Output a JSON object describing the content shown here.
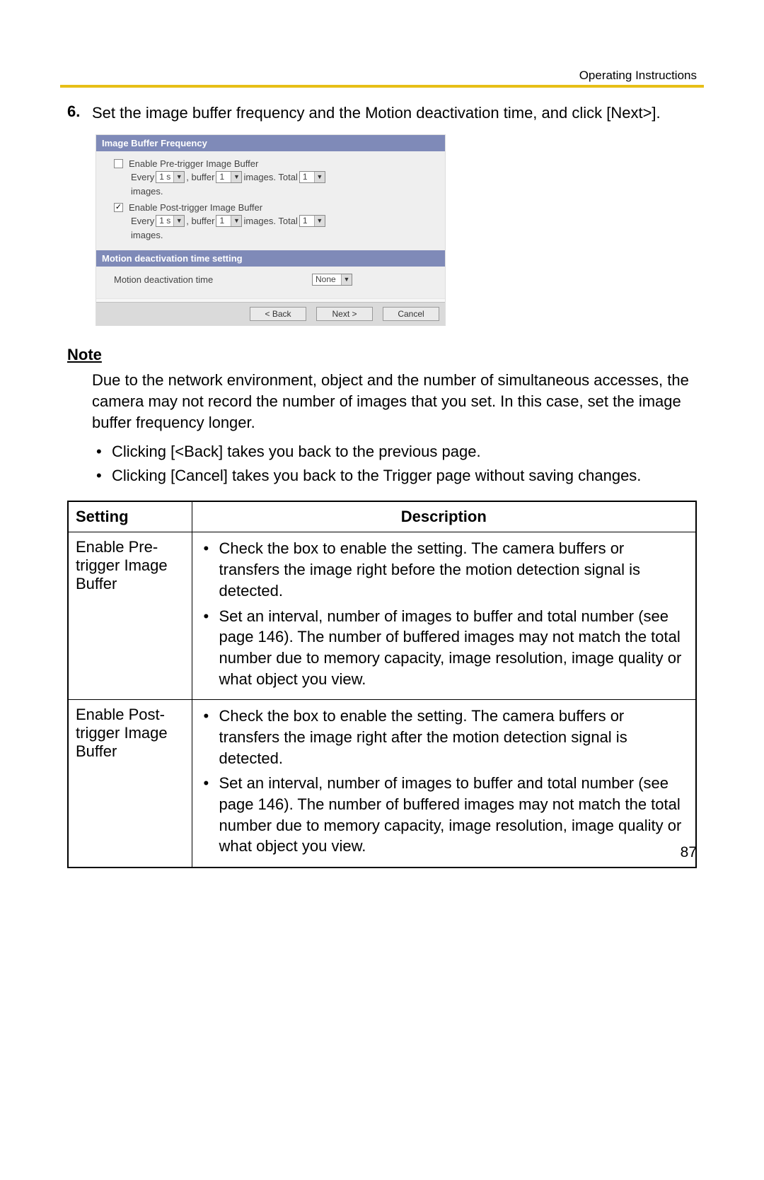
{
  "header": {
    "label": "Operating Instructions"
  },
  "step": {
    "number": "6.",
    "text": "Set the image buffer frequency and the Motion deactivation time, and click [Next>]."
  },
  "dialog": {
    "section1_title": "Image Buffer Frequency",
    "pre": {
      "checked": false,
      "label": "Enable Pre-trigger Image Buffer",
      "every_label": "Every",
      "every_value": "1 s",
      "buffer_label": ", buffer",
      "buffer_value": "1",
      "images_label": "images. Total",
      "total_value": "1",
      "trailing": "images."
    },
    "post": {
      "checked": true,
      "label": "Enable Post-trigger Image Buffer",
      "every_label": "Every",
      "every_value": "1 s",
      "buffer_label": ", buffer",
      "buffer_value": "1",
      "images_label": "images. Total",
      "total_value": "1",
      "trailing": "images."
    },
    "section2_title": "Motion deactivation time setting",
    "motion_label": "Motion deactivation time",
    "motion_value": "None",
    "buttons": {
      "back": "< Back",
      "next": "Next >",
      "cancel": "Cancel"
    }
  },
  "note": {
    "heading": "Note",
    "body": "Due to the network environment, object and the number of simultaneous accesses, the camera may not record the number of images that you set. In this case, set the image buffer frequency longer.",
    "bullets": [
      "Clicking [<Back] takes you back to the previous page.",
      "Clicking [Cancel] takes you back to the Trigger page without saving changes."
    ]
  },
  "table": {
    "headers": {
      "setting": "Setting",
      "description": "Description"
    },
    "rows": [
      {
        "setting": "Enable Pre-trigger Image Buffer",
        "desc": [
          "Check the box to enable the setting. The camera buffers or transfers the image right before the motion detection signal is detected.",
          "Set an interval, number of images to buffer and total number (see page 146). The number of buffered images may not match the total number due to memory capacity, image resolution, image quality or what object you view."
        ]
      },
      {
        "setting": "Enable Post-trigger Image Buffer",
        "desc": [
          "Check the box to enable the setting. The camera buffers or transfers the image right after the motion detection signal is detected.",
          "Set an interval, number of images to buffer and total number (see page 146). The number of buffered images may not match the total number due to memory capacity, image resolution, image quality or what object you view."
        ]
      }
    ]
  },
  "page_number": "87"
}
